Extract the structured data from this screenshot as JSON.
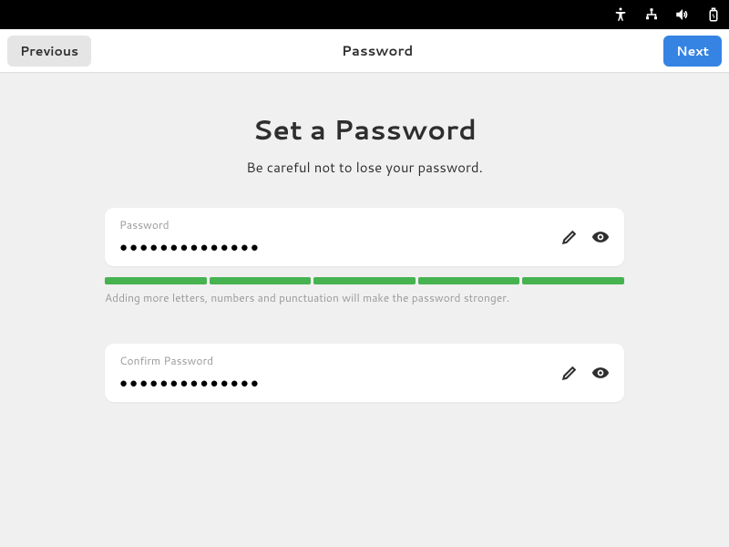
{
  "topbar": {
    "icons": [
      "accessibility",
      "network",
      "volume",
      "battery"
    ]
  },
  "header": {
    "previous_label": "Previous",
    "title": "Password",
    "next_label": "Next"
  },
  "page": {
    "title": "Set a Password",
    "subtitle": "Be careful not to lose your password."
  },
  "password_field": {
    "label": "Password",
    "value": "●●●●●●●●●●●●●●"
  },
  "strength": {
    "segments": 5,
    "color": "#46b350",
    "hint": "Adding more letters, numbers and punctuation will make the password stronger."
  },
  "confirm_field": {
    "label": "Confirm Password",
    "value": "●●●●●●●●●●●●●●"
  }
}
